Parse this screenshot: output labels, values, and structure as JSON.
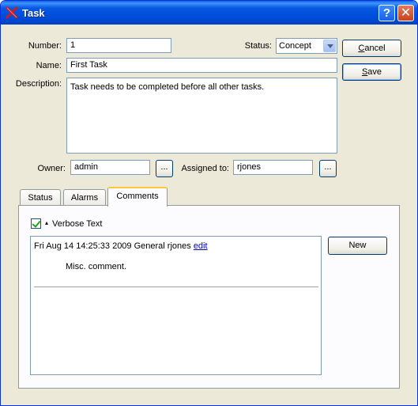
{
  "window": {
    "title": "Task",
    "help_glyph": "?",
    "close_glyph": "✕"
  },
  "form": {
    "number_label": "Number:",
    "number_value": "1",
    "status_label": "Status:",
    "status_value": "Concept",
    "name_label": "Name:",
    "name_value": "First Task",
    "description_label": "Description:",
    "description_value": "Task needs to be  completed before all other tasks.",
    "owner_label": "Owner:",
    "owner_value": "admin",
    "assigned_label": "Assigned to:",
    "assigned_value": "rjones",
    "lookup_label": "..."
  },
  "buttons": {
    "cancel_first": "C",
    "cancel_rest": "ancel",
    "save_first": "S",
    "save_rest": "ave",
    "new": "New"
  },
  "tabs": [
    {
      "label": "Status"
    },
    {
      "label": "Alarms"
    },
    {
      "label": "Comments",
      "active": true
    }
  ],
  "comments": {
    "verbose_label": "Verbose Text",
    "verbose_checked": true,
    "entry_header": "Fri Aug 14 14:25:33 2009 General rjones",
    "entry_link": "edit",
    "entry_body": "Misc. comment."
  }
}
